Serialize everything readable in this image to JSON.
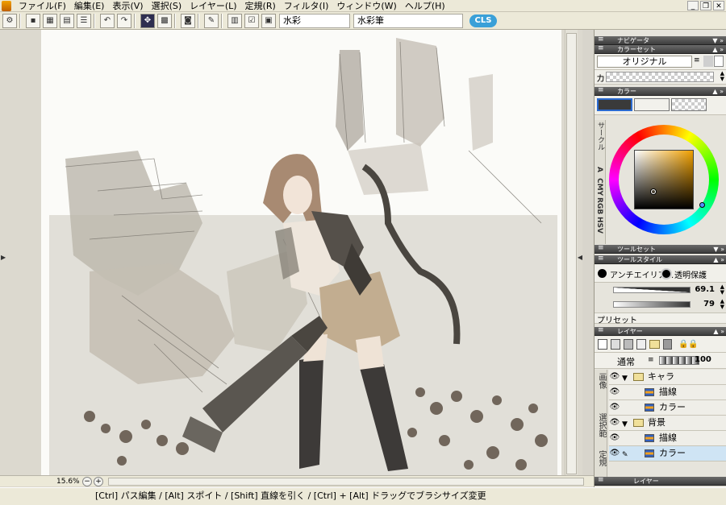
{
  "menu": [
    "ファイル(F)",
    "編集(E)",
    "表示(V)",
    "選択(S)",
    "レイヤー(L)",
    "定規(R)",
    "フィルタ(I)",
    "ウィンドウ(W)",
    "ヘルプ(H)"
  ],
  "toolbar": {
    "brush_name": "水彩",
    "brush_preset": "水彩筆",
    "logo": "CLS"
  },
  "canvas": {
    "zoom": "15.6%"
  },
  "status": {
    "hint": "[Ctrl] パス編集 / [Alt] スポイト / [Shift] 直線を引く / [Ctrl] + [Alt] ドラッグでブラシサイズ変更"
  },
  "panels": {
    "navigator": {
      "title": "ナビゲータ"
    },
    "colorset": {
      "title": "カラーセット",
      "set_name": "オリジナル",
      "row_label": "カ"
    },
    "color": {
      "title": "カラー",
      "tabs": [
        "サークル",
        "A",
        "CMY",
        "RGB",
        "HSV"
      ],
      "main_color": "#3a3a3a",
      "sub_color": "#f2f1ec"
    },
    "toolset": {
      "title": "ツールセット"
    },
    "toolstyle": {
      "title": "ツールスタイル",
      "antialias": "アンチエイリア...",
      "protect": "透明保護",
      "size": "69.1",
      "opacity": "79",
      "preset": "プリセット"
    },
    "layer": {
      "title": "レイヤー",
      "blend_mode": "通常",
      "opacity": "100",
      "side_tabs": [
        "画像",
        "選択範",
        "定規"
      ],
      "rows": [
        {
          "name": "キャラ",
          "type": "folder",
          "indent": 0
        },
        {
          "name": "描線",
          "type": "layer",
          "indent": 1
        },
        {
          "name": "カラー",
          "type": "layer",
          "indent": 1
        },
        {
          "name": "背景",
          "type": "folder",
          "indent": 0
        },
        {
          "name": "描線",
          "type": "layer",
          "indent": 1
        },
        {
          "name": "カラー",
          "type": "layer",
          "indent": 1,
          "selected": true
        }
      ],
      "footer": "レイヤー"
    }
  }
}
